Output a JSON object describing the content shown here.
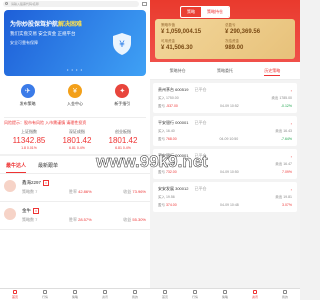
{
  "left": {
    "search_placeholder": "请输入股票代码/名称",
    "banner": {
      "line1_prefix": "为你炒股保驾护航",
      "line1_highlight": "解决困难",
      "line2": "我们实盘交易 安全资金 正规平台",
      "line3": "安全可靠有保障",
      "dots": "• • • •"
    },
    "quick": [
      {
        "label": "发布策略",
        "icon": "send-icon",
        "color": "#3b7be8",
        "glyph": "✈"
      },
      {
        "label": "入金中心",
        "icon": "wallet-icon",
        "color": "#f3a019",
        "glyph": "¥"
      },
      {
        "label": "新手指引",
        "icon": "guide-icon",
        "color": "#e8453c",
        "glyph": "✦"
      }
    ],
    "ticker": "风险提示：股市有风险 入市需谨慎 请理性投资",
    "stocks": [
      {
        "name": "上证指数",
        "value": "11342.85",
        "change": "1.8   0.01%"
      },
      {
        "name": "深证成指",
        "value": "1801.42",
        "change": "6.81   0.4%"
      },
      {
        "name": "创业板指",
        "value": "1801.42",
        "change": "6.81   0.4%"
      }
    ],
    "tabs": [
      "最牛达人",
      "最新跟单"
    ],
    "traders": [
      {
        "name": "鑫海2297",
        "badge": "V",
        "win": "7",
        "rate": "42.86%",
        "ret": "73.96%"
      },
      {
        "name": "金牛",
        "badge": "V",
        "win": "7",
        "rate": "28.57%",
        "ret": "55.30%"
      }
    ],
    "trader_labels": {
      "win": "策略数",
      "rate": "胜率",
      "ret": "收益"
    },
    "watermark": "www.99k9.net",
    "tabbar": [
      "首页",
      "行情",
      "策略",
      "资讯",
      "我的"
    ]
  },
  "right": {
    "seg": [
      "策略",
      "策略持仓"
    ],
    "card": [
      {
        "label": "策略市值",
        "value": "¥ 1,059,004.15"
      },
      {
        "label": "总盈亏",
        "value": "¥ 290,369.56"
      },
      {
        "label": "可用资金",
        "value": "¥ 41,506.30"
      },
      {
        "label": "冻结资金",
        "value": "989.00"
      }
    ],
    "tabs": [
      "策略持仓",
      "策略委托",
      "历史策略"
    ],
    "orders": [
      {
        "title": "贵州茅台 600519",
        "status": "已平仓",
        "buy": "1750.00",
        "sell": "1785.00",
        "profit": "-537.00",
        "time": "04-09 10:52",
        "pct": "-0.12%",
        "neg": true
      },
      {
        "title": "平安银行 000001",
        "status": "已平仓",
        "buy": "16.40",
        "sell": "16.43",
        "profit": "768.00",
        "time": "04-09 10:50",
        "pct": "-7.64%",
        "neg": true
      },
      {
        "title": "平安银行 000001",
        "status": "已平仓",
        "buy": "16.28",
        "sell": "16.47",
        "profit": "732.00",
        "time": "04-09 10:50",
        "pct": "7.09%",
        "neg": false
      },
      {
        "title": "安安发展 300012",
        "status": "已平仓",
        "buy": "19.56",
        "sell": "19.81",
        "profit": "374.00",
        "time": "04-09 10:48",
        "pct": "3.07%",
        "neg": false
      }
    ],
    "order_labels": {
      "buy": "买入",
      "sell": "卖出",
      "profit": "盈亏",
      "time": "时间"
    },
    "tabbar": [
      "首页",
      "行情",
      "策略",
      "资讯",
      "我的"
    ]
  }
}
